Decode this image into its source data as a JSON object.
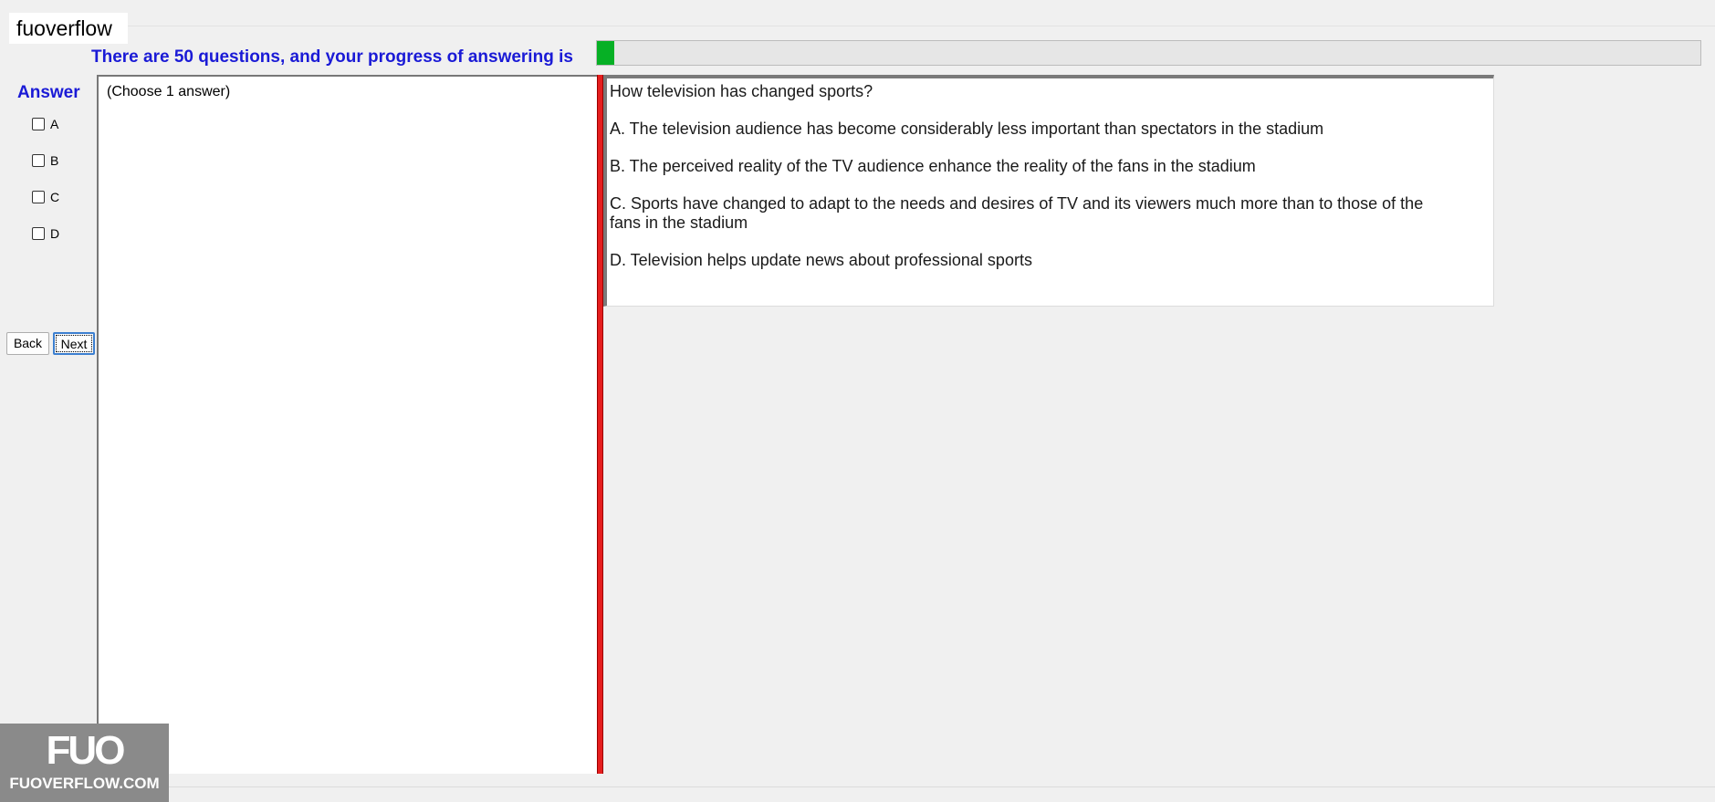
{
  "app": {
    "tab_title": "fuoverflow"
  },
  "progress": {
    "label": "There are 50 questions, and your progress of answering is",
    "fraction": 0.016
  },
  "answer_panel": {
    "title": "Answer",
    "options": [
      "A",
      "B",
      "C",
      "D"
    ]
  },
  "navigation": {
    "back_label": "Back",
    "next_label": "Next"
  },
  "answer_area": {
    "instruction": "(Choose 1 answer)"
  },
  "question": {
    "text": "How television has changed sports?",
    "choices": [
      "A.  The television audience has become considerably less important than spectators in the stadium",
      "B.  The perceived reality of the TV audience enhance the reality of the fans in the stadium",
      "C.  Sports have changed to adapt to the needs and desires of TV and its viewers much more than to those of the fans in the stadium",
      "D.  Television helps update news about professional sports"
    ]
  },
  "watermark": {
    "big": "FUO",
    "small": "FUOVERFLOW.COM"
  },
  "logo": {
    "big": "FUO",
    "small": "FUOVERFLOW.COM"
  },
  "colors": {
    "progress_fill": "#06b025",
    "heading_blue": "#1a1ad6",
    "splitter_red": "#e51e1e"
  }
}
